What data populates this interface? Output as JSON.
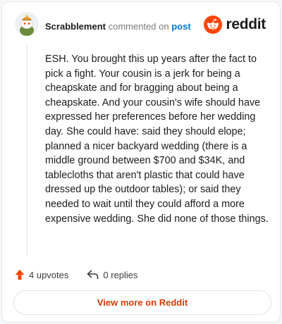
{
  "comment": {
    "author": "Scrabblement",
    "action_text": "commented on",
    "post_link": "post",
    "body": "ESH. You brought this up years after the fact to pick a fight. Your cousin is a jerk for being a cheapskate and for bragging about being a cheapskate. And your cousin's wife should have expressed her preferences before her wedding day. She could have: said they should elope; planned a nicer backyard wedding (there is a middle ground between $700 and $34K, and tablecloths that aren't plastic that could have dressed up the outdoor tables); or said they needed to wait until they could afford a more expensive wedding. She did none of those things."
  },
  "brand": {
    "name": "reddit",
    "color": "#ff4500"
  },
  "actions": {
    "upvotes_label": "4 upvotes",
    "replies_label": "0 replies"
  },
  "footer": {
    "view_more_label": "View more on Reddit"
  },
  "icons": {
    "avatar": "snoo-avatar-icon",
    "brand": "reddit-logo-icon",
    "upvote": "upvote-arrow-icon",
    "reply": "reply-arrow-icon"
  }
}
